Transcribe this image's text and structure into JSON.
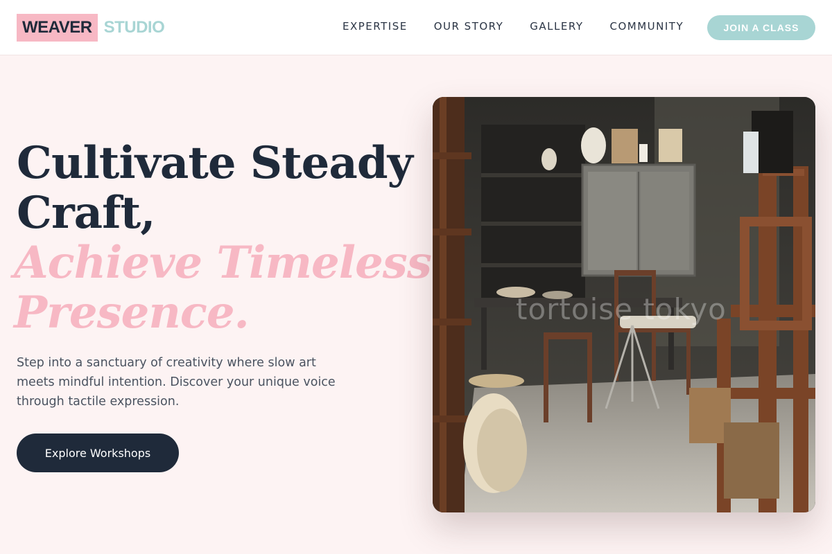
{
  "brand": {
    "primary": "WEAVER",
    "secondary": "STUDIO"
  },
  "nav": {
    "items": [
      "EXPERTISE",
      "OUR STORY",
      "GALLERY",
      "COMMUNITY"
    ]
  },
  "header": {
    "cta_label": "JOIN A CLASS"
  },
  "hero": {
    "headline_line1": "Cultivate Steady",
    "headline_line2": "Craft,",
    "accent_line1": "Achieve Timeless",
    "accent_line2": "Presence.",
    "description": "Step into a sanctuary of creativity where slow art meets mindful intention. Discover your unique voice through tactile expression.",
    "button_label": "Explore Workshops"
  },
  "image": {
    "watermark": "tortoise tokyo"
  },
  "colors": {
    "background": "#fdf3f3",
    "navy": "#1f2a3a",
    "pink": "#f7b8c4",
    "teal": "#a8d5d4"
  }
}
